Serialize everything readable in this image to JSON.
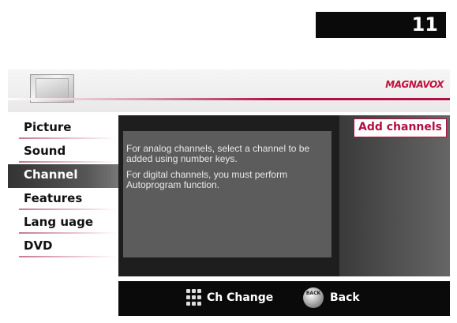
{
  "channel_number": "11",
  "brand": "MAGNAVOX",
  "menu": [
    {
      "label": "Picture"
    },
    {
      "label": "Sound"
    },
    {
      "label": "Channel"
    },
    {
      "label": "Features"
    },
    {
      "label": "Lang uage"
    },
    {
      "label": "DVD"
    }
  ],
  "active_menu": "Channel",
  "info": {
    "analog": "For analog channels, select a channel to be added using number keys.",
    "digital": "For digital channels, you must perform Autoprogram function."
  },
  "side": {
    "add_channels": "Add channels"
  },
  "footer": {
    "ch_change": "Ch Change",
    "back_icon_text": "BACK",
    "back": "Back"
  },
  "colors": {
    "accent": "#b01040",
    "background": "#1e1e1e"
  },
  "icons": {
    "tv": "tv-icon",
    "keypad": "keypad-icon",
    "back": "back-button-icon"
  }
}
